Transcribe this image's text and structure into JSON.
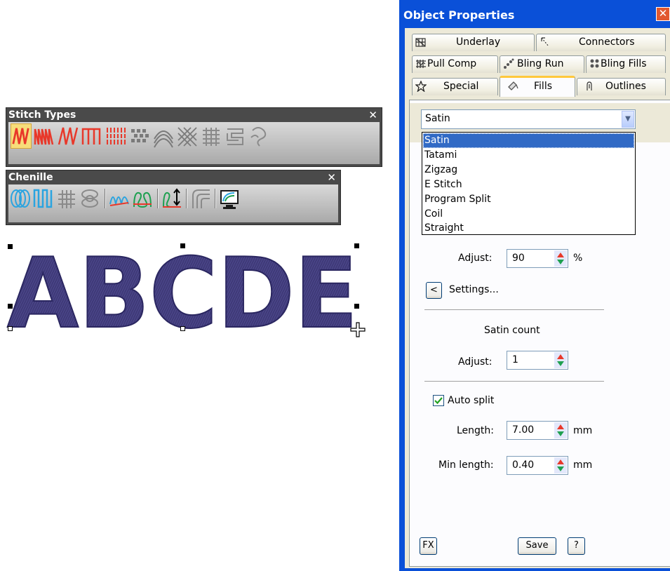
{
  "stitch_toolbar": {
    "title": "Stitch Types",
    "close_glyph": "✕",
    "icons": [
      "satin-icon",
      "tatami-icon",
      "zigzag-icon",
      "e-stitch-icon",
      "program-split-icon",
      "dot-fill-icon",
      "contour-icon",
      "cross-stitch-icon",
      "fancy-fill-icon",
      "motif-fill-icon",
      "pattern-fill-icon"
    ]
  },
  "chenille_toolbar": {
    "title": "Chenille",
    "close_glyph": "✕",
    "icons": [
      "chenille-loop-icon",
      "chenille-zigzag-icon",
      "chenille-grid-icon",
      "chenille-chain-icon",
      "chenille-outline-a-icon",
      "chenille-outline-b-icon",
      "chenille-height-icon",
      "chenille-corner-icon",
      "chenille-monitor-icon"
    ]
  },
  "canvas": {
    "text": "ABCDE",
    "fill_color": "#3c3773"
  },
  "panel": {
    "title": "Object Properties",
    "close_glyph": "✕",
    "tabs": [
      {
        "label": "Underlay",
        "icon": "underlay-icon"
      },
      {
        "label": "Connectors",
        "icon": "connectors-icon"
      },
      {
        "label": "Pull Comp",
        "icon": "pull-comp-icon"
      },
      {
        "label": "Bling Run",
        "icon": "bling-run-icon"
      },
      {
        "label": "Bling Fills",
        "icon": "bling-fills-icon"
      },
      {
        "label": "Special",
        "icon": "star-icon"
      },
      {
        "label": "Fills",
        "icon": "fills-icon"
      },
      {
        "label": "Outlines",
        "icon": "outlines-icon"
      }
    ],
    "active_tab": "Fills",
    "fill_type": {
      "selected": "Satin",
      "options": [
        "Satin",
        "Tatami",
        "Zigzag",
        "E Stitch",
        "Program Split",
        "Coil",
        "Straight"
      ]
    },
    "adjust_label": "Adjust:",
    "adjust_value": "90",
    "adjust_unit": "%",
    "settings_label": "Settings...",
    "settings_button": "<",
    "satin_count_title": "Satin count",
    "satin_adjust_label": "Adjust:",
    "satin_adjust_value": "1",
    "auto_split_label": "Auto split",
    "auto_split_checked": true,
    "length_label": "Length:",
    "length_value": "7.00",
    "length_unit": "mm",
    "min_length_label": "Min length:",
    "min_length_value": "0.40",
    "min_length_unit": "mm",
    "fx_button": "FX",
    "save_button": "Save",
    "help_button": "?"
  },
  "colors": {
    "panel_blue": "#0a50d8",
    "selection": "#316ac5",
    "toolbar_red": "#e8382a",
    "toolbar_blue": "#2aa4e0",
    "active_tab_accent": "#ffc83c"
  }
}
